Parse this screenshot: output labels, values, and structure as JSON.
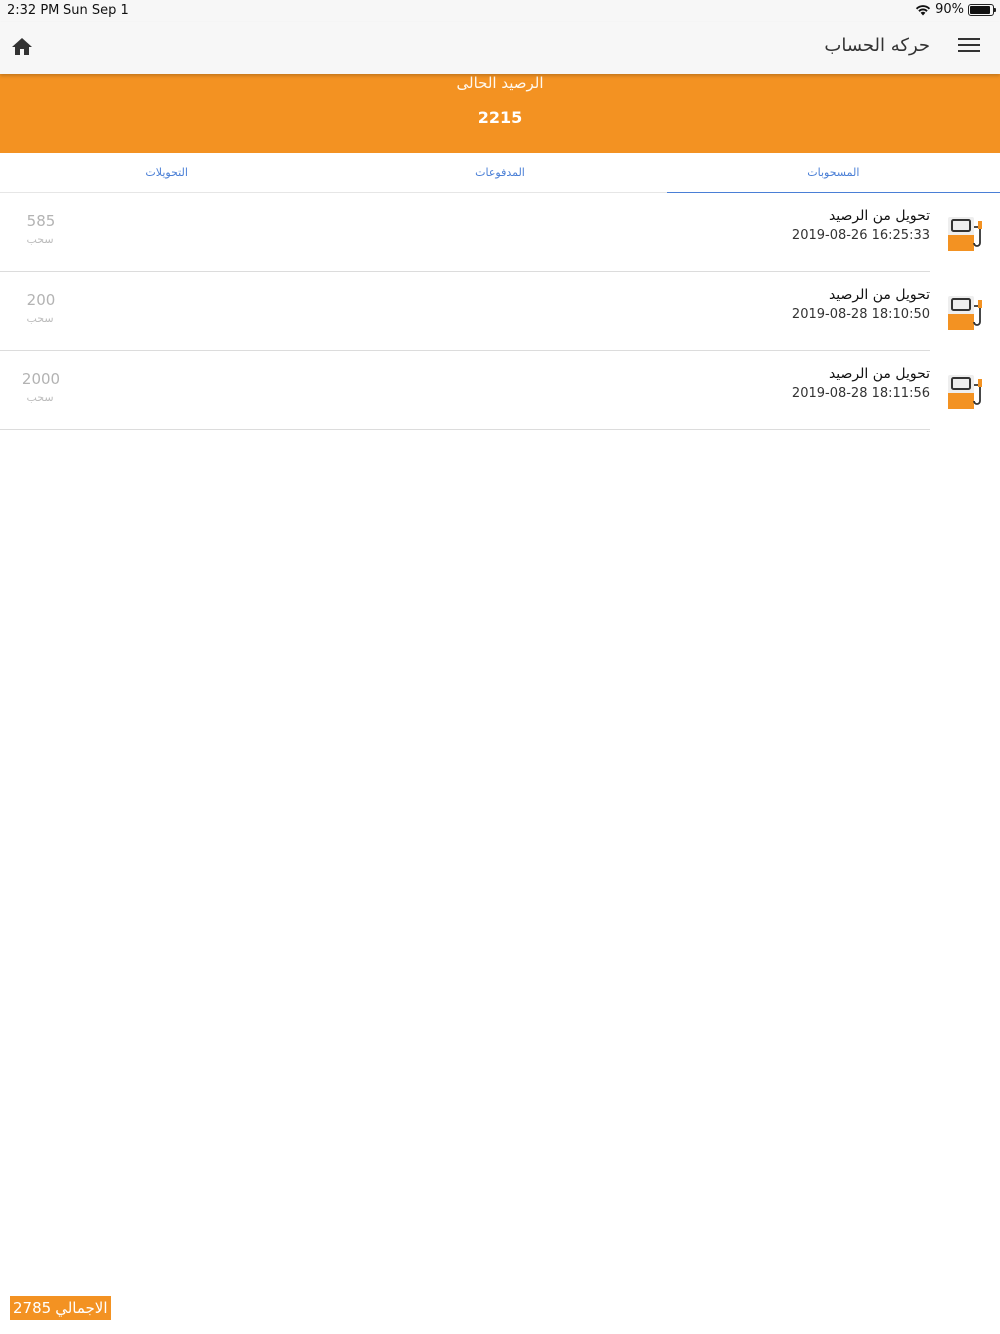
{
  "status": {
    "time": "2:32 PM",
    "date": "Sun Sep 1",
    "battery": "90%",
    "battery_level": 0.9
  },
  "app_bar": {
    "title": "حركه الحساب",
    "home_icon": "home-icon",
    "menu_icon": "menu-icon"
  },
  "balance": {
    "label": "الرصيد الحالى",
    "value": "2215"
  },
  "tabs": [
    {
      "label": "التحويلات",
      "active": false
    },
    {
      "label": "المدفوعات",
      "active": false
    },
    {
      "label": "المسحوبات",
      "active": true
    }
  ],
  "transactions": [
    {
      "title": "تحويل من الرصيد",
      "date": "2019-08-26 16:25:33",
      "amount": "585",
      "type": "سحب"
    },
    {
      "title": "تحويل من الرصيد",
      "date": "2019-08-28 18:10:50",
      "amount": "200",
      "type": "سحب"
    },
    {
      "title": "تحويل من الرصيد",
      "date": "2019-08-28 18:11:56",
      "amount": "2000",
      "type": "سحب"
    }
  ],
  "total": {
    "label": "الاجمالي",
    "value": "2785"
  },
  "colors": {
    "accent": "#f39222",
    "tab_text": "#4a7fd6"
  }
}
